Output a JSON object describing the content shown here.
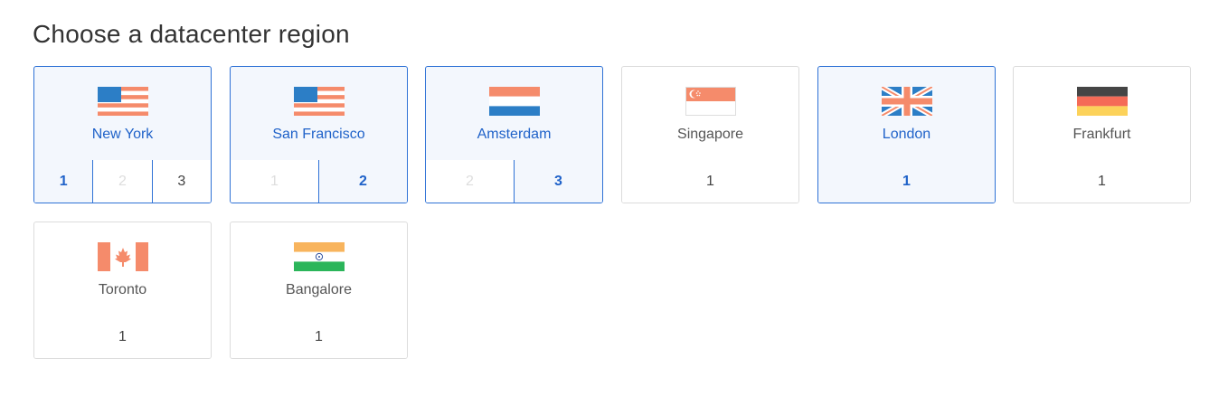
{
  "title": "Choose a datacenter region",
  "regions": [
    {
      "name": "New York",
      "flag": "us-flag",
      "selected": true,
      "numbers": [
        {
          "label": "1",
          "state": "active"
        },
        {
          "label": "2",
          "state": "disabled"
        },
        {
          "label": "3",
          "state": "normal"
        }
      ]
    },
    {
      "name": "San Francisco",
      "flag": "us-flag",
      "selected": true,
      "numbers": [
        {
          "label": "1",
          "state": "disabled"
        },
        {
          "label": "2",
          "state": "active"
        }
      ]
    },
    {
      "name": "Amsterdam",
      "flag": "netherlands-flag",
      "selected": true,
      "numbers": [
        {
          "label": "2",
          "state": "disabled"
        },
        {
          "label": "3",
          "state": "active"
        }
      ]
    },
    {
      "name": "Singapore",
      "flag": "singapore-flag",
      "selected": false,
      "numbers": [
        {
          "label": "1",
          "state": "normal"
        }
      ]
    },
    {
      "name": "London",
      "flag": "uk-flag",
      "selected": true,
      "numbers": [
        {
          "label": "1",
          "state": "active"
        }
      ]
    },
    {
      "name": "Frankfurt",
      "flag": "germany-flag",
      "selected": false,
      "numbers": [
        {
          "label": "1",
          "state": "normal"
        }
      ]
    },
    {
      "name": "Toronto",
      "flag": "canada-flag",
      "selected": false,
      "numbers": [
        {
          "label": "1",
          "state": "normal"
        }
      ]
    },
    {
      "name": "Bangalore",
      "flag": "india-flag",
      "selected": false,
      "numbers": [
        {
          "label": "1",
          "state": "normal"
        }
      ]
    }
  ],
  "colors": {
    "accent": "#2f72d6",
    "selected_bg": "#f3f7fd",
    "selected_text": "#1f62c9",
    "border": "#dcdcdc"
  }
}
